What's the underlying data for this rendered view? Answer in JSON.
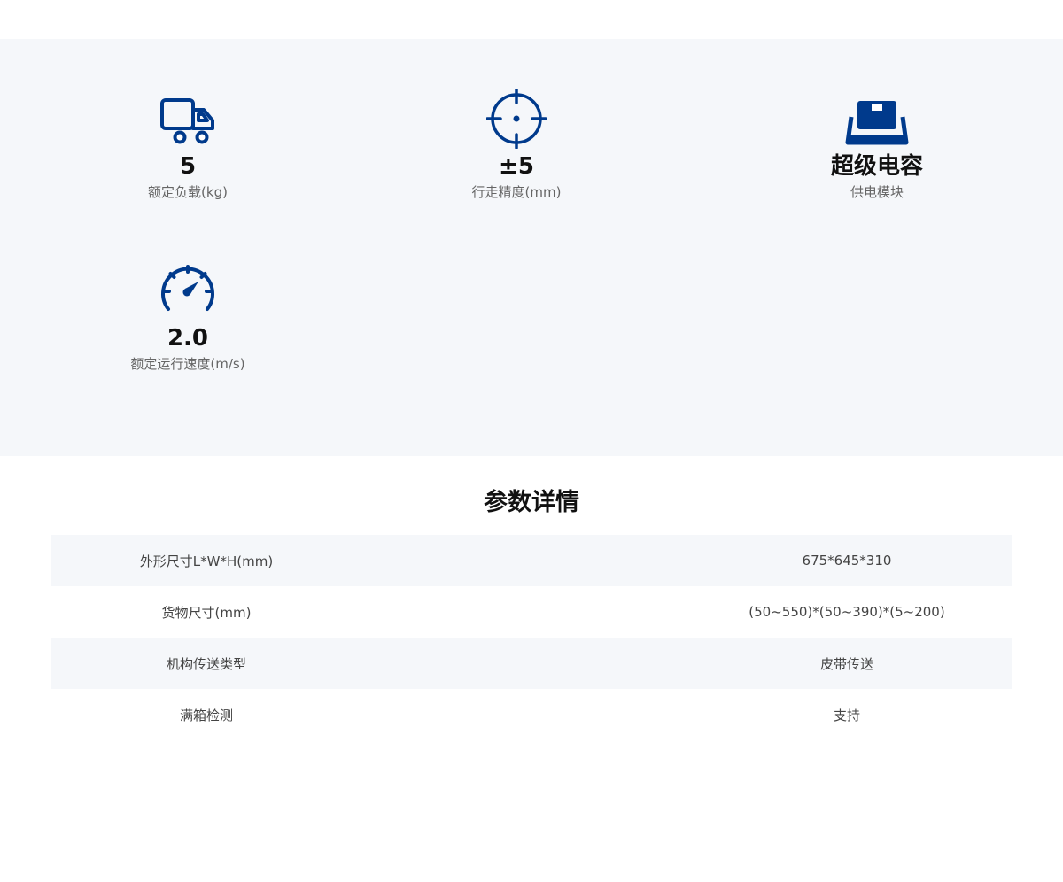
{
  "features": [
    {
      "icon": "truck-icon",
      "value": "5",
      "label": "额定负载(kg)"
    },
    {
      "icon": "crosshair-icon",
      "value": "±5",
      "label": "行走精度(mm)"
    },
    {
      "icon": "box-platform-icon",
      "value": "超级电容",
      "label": "供电模块"
    },
    {
      "icon": "speedometer-icon",
      "value": "2.0",
      "label": "额定运行速度(m/s)"
    }
  ],
  "params": {
    "title": "参数详情",
    "rows": [
      {
        "key": "外形尺寸L*W*H(mm)",
        "value": "675*645*310"
      },
      {
        "key": "货物尺寸(mm)",
        "value": "(50~550)*(50~390)*(5~200)"
      },
      {
        "key": "机构传送类型",
        "value": "皮带传送"
      },
      {
        "key": "满箱检测",
        "value": "支持"
      }
    ]
  },
  "colors": {
    "icon": "#003a8c",
    "section_bg": "#f5f7fa",
    "title": "#111111",
    "label": "#666666"
  }
}
